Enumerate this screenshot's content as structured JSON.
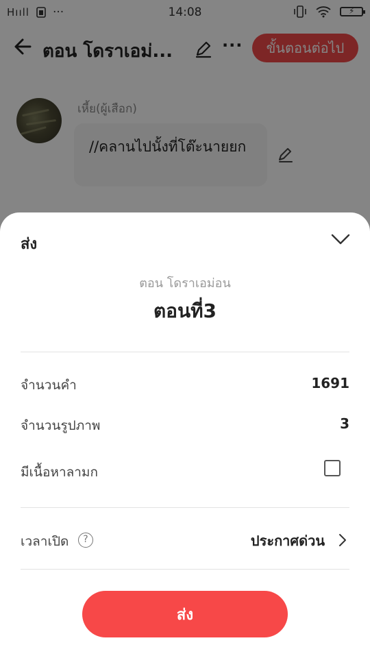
{
  "status_bar": {
    "signal": "Hııll",
    "time": "14:08"
  },
  "header": {
    "title": "ตอน โดราเอม่...",
    "next_label": "ขั้นตอนต่อไป"
  },
  "chat": {
    "speaker": "เหี้ย(ผู้เสือก)",
    "message": "//คลานไปนั้งที่โต๊ะนายยก"
  },
  "sheet": {
    "title": "ส่ง",
    "story_name": "ตอน โดราเอม่อน",
    "chapter": "ตอนที่3",
    "word_count_label": "จำนวนคำ",
    "word_count": "1691",
    "image_count_label": "จำนวนรูปภาพ",
    "image_count": "3",
    "mature_label": "มีเนื้อหาลามก",
    "mature_checked": false,
    "publish_time_label": "เวลาเปิด",
    "help_glyph": "?",
    "publish_time_value": "ประกาศด่วน",
    "send_label": "ส่ง"
  },
  "colors": {
    "accent": "#f74848",
    "overlay": "rgba(0,0,0,0.48)"
  },
  "icons": [
    "back-arrow-icon",
    "pencil-icon",
    "more-icon",
    "chevron-down-icon",
    "help-icon",
    "chevron-right-icon"
  ]
}
